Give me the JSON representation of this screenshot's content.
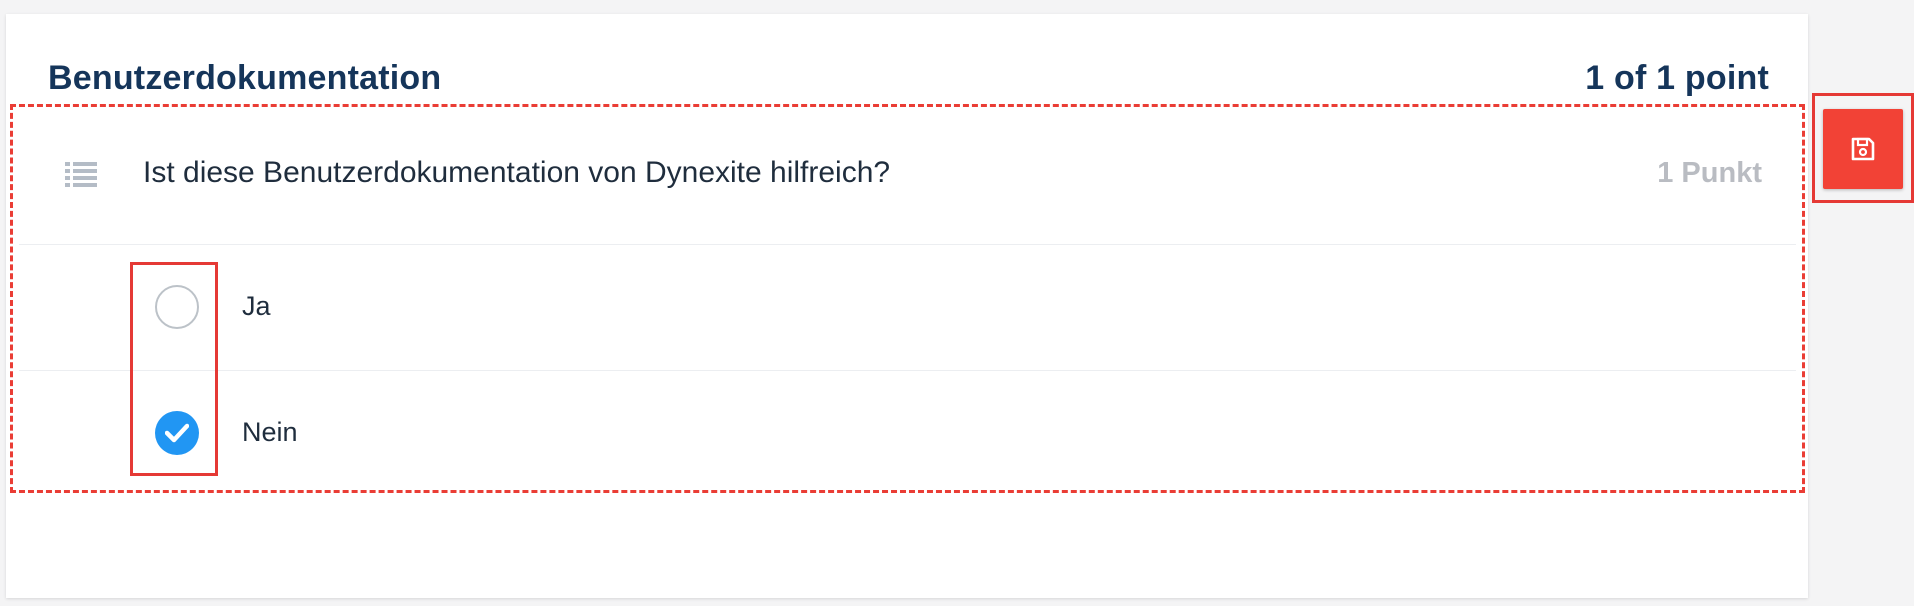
{
  "card": {
    "title": "Benutzerdokumentation",
    "score": "1 of 1 point"
  },
  "question": {
    "icon": "list-icon",
    "text": "Ist diese Benutzerdokumentation von Dynexite hilfreich?",
    "points": "1 Punkt",
    "options": [
      {
        "label": "Ja",
        "selected": false
      },
      {
        "label": "Nein",
        "selected": true
      }
    ]
  },
  "toolbar": {
    "save_icon": "floppy-disk-icon"
  },
  "colors": {
    "title": "#15355a",
    "accent": "#2196f3",
    "save_button": "#f24236",
    "highlight": "#e53935",
    "muted_points": "#b9bcc2"
  }
}
